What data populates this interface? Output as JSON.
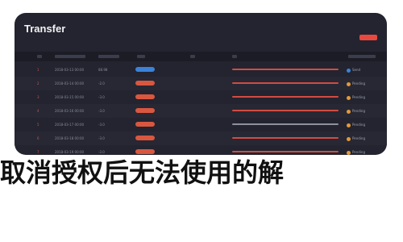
{
  "window": {
    "title": "Transfer"
  },
  "rows": [
    {
      "id": "1",
      "date": "2018-03-13 00:00",
      "amount": "88.98",
      "status_color": "#3b82d8",
      "desc_style": "red",
      "stat_label": "Send"
    },
    {
      "id": "2",
      "date": "2018-03-14 00:00",
      "amount": "-2.0",
      "status_color": "#d9573f",
      "desc_style": "red",
      "stat_label": "Pending"
    },
    {
      "id": "3",
      "date": "2018-03-15 00:00",
      "amount": "-3.0",
      "status_color": "#d9573f",
      "desc_style": "red",
      "stat_label": "Pending"
    },
    {
      "id": "4",
      "date": "2018-03-16 00:00",
      "amount": "-3.0",
      "status_color": "#d9573f",
      "desc_style": "red",
      "stat_label": "Pending"
    },
    {
      "id": "5",
      "date": "2018-03-17 00:00",
      "amount": "-3.0",
      "status_color": "#d9573f",
      "desc_style": "gray",
      "stat_label": "Pending"
    },
    {
      "id": "6",
      "date": "2018-03-18 00:00",
      "amount": "-3.0",
      "status_color": "#d9573f",
      "desc_style": "red",
      "stat_label": "Pending"
    },
    {
      "id": "7",
      "date": "2018-03-19 00:00",
      "amount": "-3.0",
      "status_color": "#d9573f",
      "desc_style": "red",
      "stat_label": "Pending"
    }
  ],
  "caption": {
    "text": "取消授权后无法使用的解"
  },
  "colors": {
    "accent_red": "#e8493f",
    "accent_blue": "#3b82d8",
    "card_bg": "#23242f"
  }
}
